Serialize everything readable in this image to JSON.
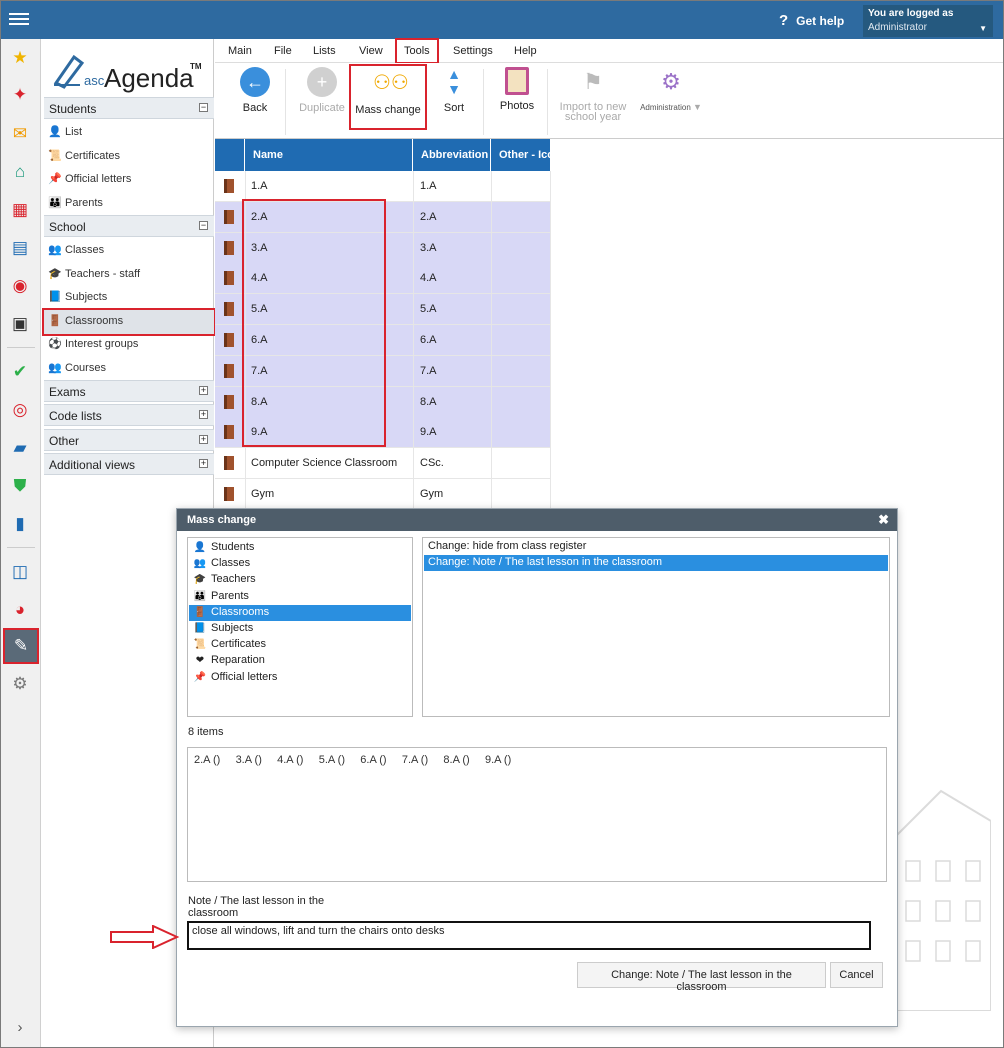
{
  "topbar": {
    "get_help": "Get help",
    "logged_label": "You are logged as",
    "logged_user": "Administrator"
  },
  "logo": {
    "asc": "asc",
    "name": "Agenda",
    "tm": "TM"
  },
  "sidebar": {
    "students_label": "Students",
    "students_items": [
      {
        "label": "List",
        "icon": "👤"
      },
      {
        "label": "Certificates",
        "icon": "📜"
      },
      {
        "label": "Official letters",
        "icon": "📌"
      },
      {
        "label": "Parents",
        "icon": "👪"
      }
    ],
    "school_label": "School",
    "school_items": [
      {
        "label": "Classes",
        "icon": "👥"
      },
      {
        "label": "Teachers - staff",
        "icon": "🎓"
      },
      {
        "label": "Subjects",
        "icon": "📘"
      },
      {
        "label": "Classrooms",
        "icon": "🚪"
      },
      {
        "label": "Interest groups",
        "icon": "⚽"
      },
      {
        "label": "Courses",
        "icon": "👥"
      }
    ],
    "exams_label": "Exams",
    "codelists_label": "Code lists",
    "other_label": "Other",
    "additional_label": "Additional views"
  },
  "menu": [
    "Main",
    "File",
    "Lists",
    "View",
    "Tools",
    "Settings",
    "Help"
  ],
  "toolbar": {
    "back": "Back",
    "duplicate": "Duplicate",
    "mass_change": "Mass change",
    "sort": "Sort",
    "photos": "Photos",
    "import1": "Import to new",
    "import2": "school year",
    "administration": "Administration"
  },
  "grid": {
    "headers": [
      "Name",
      "Abbreviation",
      "Other - Ico"
    ],
    "rows": [
      {
        "name": "1.A",
        "abbr": "1.A"
      },
      {
        "name": "2.A",
        "abbr": "2.A"
      },
      {
        "name": "3.A",
        "abbr": "3.A"
      },
      {
        "name": "4.A",
        "abbr": "4.A"
      },
      {
        "name": "5.A",
        "abbr": "5.A"
      },
      {
        "name": "6.A",
        "abbr": "6.A"
      },
      {
        "name": "7.A",
        "abbr": "7.A"
      },
      {
        "name": "8.A",
        "abbr": "8.A"
      },
      {
        "name": "9.A",
        "abbr": "9.A"
      },
      {
        "name": "Computer Science Classroom",
        "abbr": "CSc."
      },
      {
        "name": "Gym",
        "abbr": "Gym"
      }
    ]
  },
  "dialog": {
    "title": "Mass change",
    "types": [
      {
        "label": "Students",
        "icon": "👤"
      },
      {
        "label": "Classes",
        "icon": "👥"
      },
      {
        "label": "Teachers",
        "icon": "🎓"
      },
      {
        "label": "Parents",
        "icon": "👪"
      },
      {
        "label": "Classrooms",
        "icon": "🚪"
      },
      {
        "label": "Subjects",
        "icon": "📘"
      },
      {
        "label": "Certificates",
        "icon": "📜"
      },
      {
        "label": "Reparation",
        "icon": "❤"
      },
      {
        "label": "Official letters",
        "icon": "📌"
      }
    ],
    "changes": [
      "Change: hide from class register",
      "Change: Note / The last lesson in the classroom"
    ],
    "items_count": "8 items",
    "items_text": "2.A ()     3.A ()     4.A ()     5.A ()     6.A ()     7.A ()     8.A ()     9.A ()",
    "note_label1": "Note / The last lesson in the",
    "note_label2": "classroom",
    "note_value": "close all windows, lift and turn the chairs onto desks",
    "apply_button": "Change: Note / The last lesson in the classroom",
    "cancel_button": "Cancel"
  },
  "colors": {
    "topbar": "#2e6aa0",
    "highlight": "#d9232d",
    "selection": "#d8d8f6",
    "grid_header": "#1f6bb2",
    "selected_item": "#2a8fe0"
  }
}
